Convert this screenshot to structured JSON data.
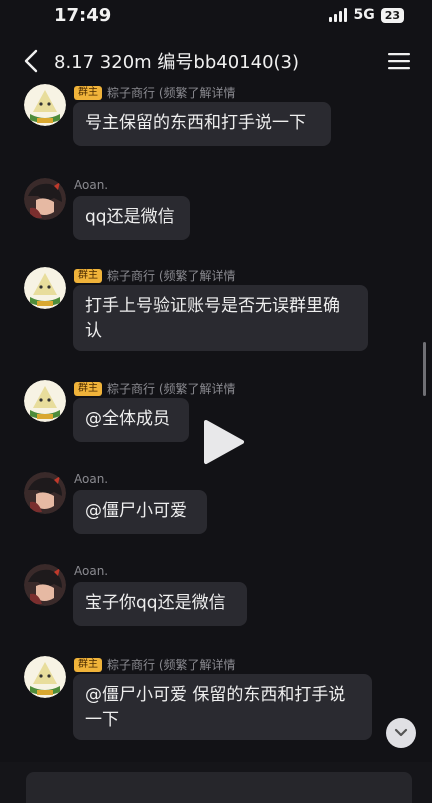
{
  "status_bar": {
    "time": "17:49",
    "network": "5G",
    "battery": "23"
  },
  "nav": {
    "title": "8.17 320m 编号bb40140(3)"
  },
  "messages": [
    {
      "sender": "粽子商行 (频繁了解详情",
      "badge": "群主",
      "avatar": "zongzi",
      "text": "号主保留的东西和打手说一下"
    },
    {
      "sender": "Aoan.",
      "badge": "",
      "avatar": "anime",
      "text": "qq还是微信"
    },
    {
      "sender": "粽子商行 (频繁了解详情",
      "badge": "群主",
      "avatar": "zongzi",
      "text": "打手上号验证账号是否无误群里确认"
    },
    {
      "sender": "粽子商行 (频繁了解详情",
      "badge": "群主",
      "avatar": "zongzi",
      "text": "@全体成员"
    },
    {
      "sender": "Aoan.",
      "badge": "",
      "avatar": "anime",
      "text": "@僵尸小可爱"
    },
    {
      "sender": "Aoan.",
      "badge": "",
      "avatar": "anime",
      "text": "宝子你qq还是微信"
    },
    {
      "sender": "粽子商行 (频繁了解详情",
      "badge": "群主",
      "avatar": "zongzi",
      "text": "@僵尸小可爱 保留的东西和打手说一下"
    }
  ],
  "icons": {
    "back": "back-arrow-icon",
    "menu": "hamburger-menu-icon",
    "play": "play-icon",
    "scroll_down": "chevron-down-icon"
  },
  "colors": {
    "badge": "#f0b33a",
    "bubble": "#2a2a30",
    "background": "#121216"
  }
}
